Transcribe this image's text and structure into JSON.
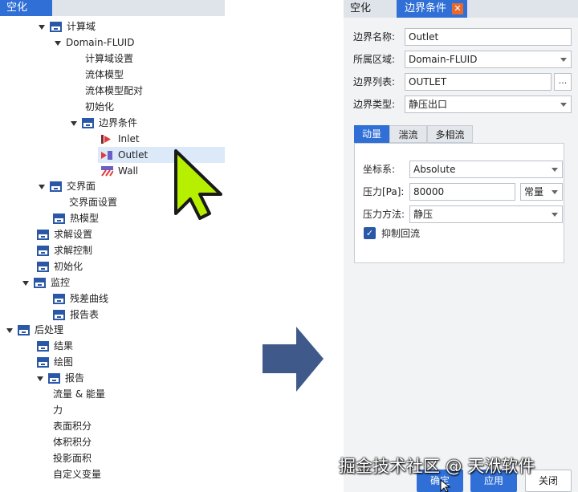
{
  "left_panel": {
    "tab": "空化",
    "tree": [
      {
        "label": "计算域",
        "arrow": true,
        "folder": true
      },
      {
        "label": "Domain-FLUID",
        "arrow": true,
        "folder": false
      },
      {
        "label": "计算域设置"
      },
      {
        "label": "流体模型"
      },
      {
        "label": "流体模型配对"
      },
      {
        "label": "初始化"
      },
      {
        "label": "边界条件",
        "arrow": true,
        "folder": true
      },
      {
        "label": "Inlet",
        "icon": "inlet-boundary-icon"
      },
      {
        "label": "Outlet",
        "icon": "outlet-boundary-icon",
        "selected": true
      },
      {
        "label": "Wall",
        "icon": "wall-boundary-icon"
      },
      {
        "label": "交界面",
        "arrow": true,
        "folder": true
      },
      {
        "label": "交界面设置"
      },
      {
        "label": "热模型",
        "folder": true
      },
      {
        "label": "求解设置",
        "folder": true
      },
      {
        "label": "求解控制",
        "folder": true
      },
      {
        "label": "初始化",
        "folder": true
      },
      {
        "label": "监控",
        "arrow": true,
        "folder": true
      },
      {
        "label": "残差曲线",
        "folder": true
      },
      {
        "label": "报告表",
        "folder": true
      },
      {
        "label": "后处理",
        "arrow": true,
        "folder": true
      },
      {
        "label": "结果",
        "folder": true
      },
      {
        "label": "绘图",
        "folder": true
      },
      {
        "label": "报告",
        "arrow": true,
        "folder": true
      },
      {
        "label": "流量 & 能量"
      },
      {
        "label": "力"
      },
      {
        "label": "表面积分"
      },
      {
        "label": "体积积分"
      },
      {
        "label": "投影面积"
      },
      {
        "label": "自定义变量"
      }
    ]
  },
  "right_panel": {
    "tabs": [
      "空化",
      "边界条件"
    ],
    "close_icon": "close-icon",
    "fields": {
      "name_label": "边界名称:",
      "name_value": "Outlet",
      "region_label": "所属区域:",
      "region_value": "Domain-FLUID",
      "list_label": "边界列表:",
      "list_value": "OUTLET",
      "list_button": "...",
      "type_label": "边界类型:",
      "type_value": "静压出口"
    },
    "subtabs": [
      "动量",
      "湍流",
      "多相流"
    ],
    "momentum": {
      "coord_label": "坐标系:",
      "coord_value": "Absolute",
      "pressure_label": "压力[Pa]:",
      "pressure_value": "80000",
      "pressure_mode": "常量",
      "method_label": "压力方法:",
      "method_value": "静压",
      "backflow_label": "抑制回流",
      "backflow_checked": true
    },
    "buttons": [
      "确定",
      "应用",
      "关闭"
    ]
  },
  "watermark": "掘金技术社区 @ 天洑软件",
  "colors": {
    "accent": "#2f6fd6",
    "folder": "#2b58a6",
    "selection": "#dbe9f9",
    "cursor": "#b6ef00",
    "arrow": "#3f5a8a"
  }
}
